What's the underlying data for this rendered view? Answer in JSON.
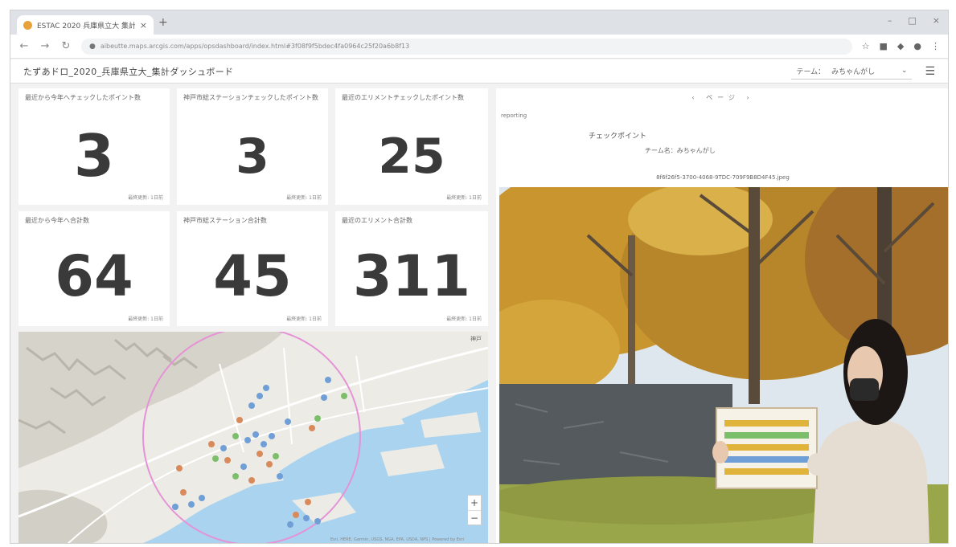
{
  "browser": {
    "tab_title": "ESTAC 2020 兵庫県立大 集計",
    "tab_close": "×",
    "new_tab": "+",
    "window_controls": [
      "–",
      "□",
      "×"
    ],
    "url": "aibeutte.maps.arcgis.com/apps/opsdashboard/index.html#3f08f9f5bdec4fa0964c25f20a6b8f13",
    "toolbar_icons": [
      "star-icon",
      "extensions-icon",
      "profile-icon",
      "more-icon"
    ]
  },
  "dashboard": {
    "title": "たずあドロ_2020_兵庫県立大_集計ダッシュボード",
    "theme_label": "テーム：",
    "theme_value": "みちゃんがし",
    "theme_chevron": "⌄",
    "menu_glyph": "☰"
  },
  "cards": [
    {
      "title": "最近から今年へチェックしたポイント数",
      "value": "3",
      "footer": "最終更新: 1日前"
    },
    {
      "title": "神戸市総ステーションチェックしたポイント数",
      "value": "3",
      "footer": "最終更新: 1日前"
    },
    {
      "title": "最近のエリメントチェックしたポイント数",
      "value": "25",
      "footer": "最終更新: 1日前"
    },
    {
      "title": "最近から今年へ合計数",
      "value": "64",
      "footer": "最終更新: 1日前"
    },
    {
      "title": "神戸市総ステーション合計数",
      "value": "45",
      "footer": "最終更新: 1日前"
    },
    {
      "title": "最近のエリメント合計数",
      "value": "311",
      "footer": "最終更新: 1日前"
    }
  ],
  "map": {
    "top_label": "神戸",
    "zoom_in": "+",
    "zoom_out": "−",
    "attribution": "Esri, HERE, Garmin, USGS, NGA, EPA, USDA, NPS | Powered by Esri",
    "colors": {
      "land": "#ecebe5",
      "water": "#a9d3ee",
      "relief": "#c9c6bd",
      "road": "#ffffff",
      "circle": "#e592d6"
    },
    "marker_colors": {
      "blue": "#6f9fd6",
      "orange": "#d98a5a",
      "green": "#7cbf6a"
    }
  },
  "detail": {
    "pager": "‹ ページ ›",
    "label": "reporting",
    "heading": "チェックポイント",
    "team": "チーム名：みちゃんがし",
    "filename": "8f6f26f5-3700-4068-9TDC-709F9B8D4F45.jpeg"
  },
  "photo": {
    "colors": {
      "sky": "#dfe7ee",
      "foliage": "#c8952f",
      "foliage_dark": "#8e6a2a",
      "wall": "#555a5e",
      "grass": "#9aa64a",
      "coat": "#e6ddd2",
      "hair": "#1c1714"
    }
  }
}
